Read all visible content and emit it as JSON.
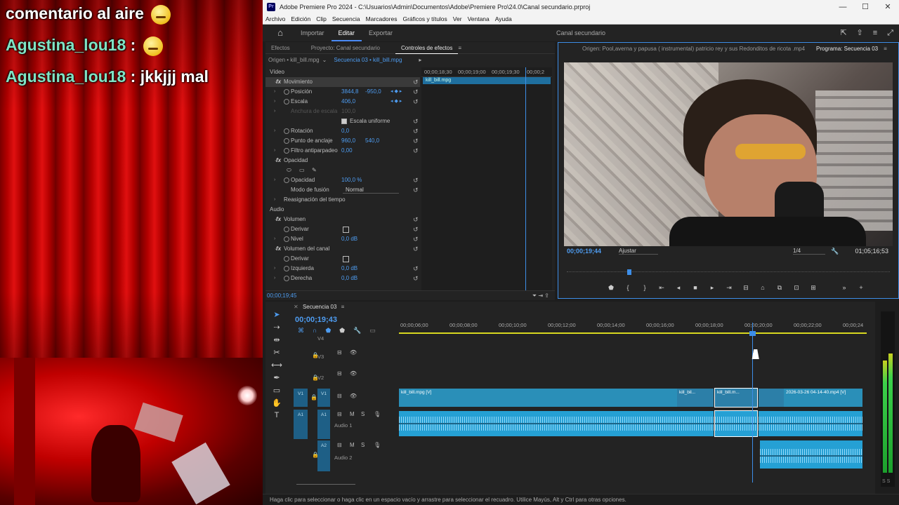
{
  "overlay": {
    "chat": [
      {
        "user": "",
        "text": "comentario al aire"
      },
      {
        "user": "Agustina_lou18",
        "text": " : "
      },
      {
        "user": "Agustina_lou18",
        "text": " : jkkjjj mal"
      }
    ]
  },
  "window": {
    "title": "Adobe Premiere Pro 2024 - C:\\Usuarios\\Admin\\Documentos\\Adobe\\Premiere Pro\\24.0\\Canal secundario.prproj",
    "logo": "Pr",
    "controls": [
      "minimize-icon",
      "maximize-icon",
      "close-icon"
    ]
  },
  "menu": [
    "Archivo",
    "Edición",
    "Clip",
    "Secuencia",
    "Marcadores",
    "Gráficos y títulos",
    "Ver",
    "Ventana",
    "Ayuda"
  ],
  "workspace": {
    "tabs": [
      "Importar",
      "Editar",
      "Exportar"
    ],
    "active": "Editar",
    "center": "Canal secundario"
  },
  "effect_controls": {
    "tabs": [
      "Efectos",
      "Proyecto: Canal secundario",
      "Controles de efectos"
    ],
    "source": "Origen • kill_bill.mpg",
    "sequence": "Secuencia 03 • kill_bill.mpg",
    "ruler": [
      "00;00;18;30",
      "00;00;19;00",
      "00;00;19;30",
      "00;00;2"
    ],
    "clip_label": "kill_bill.mpg",
    "video_label": "Vídeo",
    "audio_label": "Audio",
    "motion": "Movimiento",
    "position": {
      "label": "Posición",
      "x": "3844,8",
      "y": "-950,0"
    },
    "scale": {
      "label": "Escala",
      "value": "406,0"
    },
    "scale_width": {
      "label": "Anchura de escala",
      "value": "100,0"
    },
    "uniform": "Escala uniforme",
    "rotation": {
      "label": "Rotación",
      "value": "0,0"
    },
    "anchor": {
      "label": "Punto de anclaje",
      "x": "960,0",
      "y": "540,0"
    },
    "flicker": {
      "label": "Filtro antiparpadeo",
      "value": "0,00"
    },
    "opacity_section": "Opacidad",
    "opacity": {
      "label": "Opacidad",
      "value": "100,0 %"
    },
    "blend": {
      "label": "Modo de fusión",
      "value": "Normal"
    },
    "time_remap": "Reasignación del tiempo",
    "volume": "Volumen",
    "bypass": "Derivar",
    "level": {
      "label": "Nivel",
      "value": "0,0 dB"
    },
    "channel_volume": "Volumen del canal",
    "left": {
      "label": "Izquierda",
      "value": "0,0 dB"
    },
    "right": {
      "label": "Derecha",
      "value": "0,0 dB"
    },
    "timecode": "00;00;19;45"
  },
  "program": {
    "tabs": [
      "Origen: Pool,averna y papusa ( instrumental) patricio rey y sus Redonditos de ricota .mp4",
      "Programa: Secuencia 03"
    ],
    "timecode": "00;00;19;44",
    "fit": "Ajustar",
    "resolution": "1/4",
    "duration": "01;05;16;53"
  },
  "timeline": {
    "tab": "Secuencia 03",
    "timecode": "00;00;19;43",
    "ruler": [
      "00;00;06;00",
      "00;00;08;00",
      "00;00;10;00",
      "00;00;12;00",
      "00;00;14;00",
      "00;00;16;00",
      "00;00;18;00",
      "00;00;20;00",
      "00;00;22;00",
      "00;00;24"
    ],
    "tracks": {
      "v4": "V4",
      "v3": "V3",
      "v2": "V2",
      "v1": "V1",
      "a1": "A1",
      "a2": "A2",
      "audio1": "Audio 1",
      "audio2": "Audio 2"
    },
    "clips": {
      "main": "kill_bill.mpg [V]",
      "short1": "kill_bil...",
      "short2": "kill_bill.m...",
      "last": "2026-03-26 04-14-40.mp4 [V]"
    }
  },
  "status": "Haga clic para seleccionar o haga clic en un espacio vacío y arrastre para seleccionar el recuadro. Utilice Mayús, Alt y Ctrl para otras opciones.",
  "meter_label": "S S"
}
